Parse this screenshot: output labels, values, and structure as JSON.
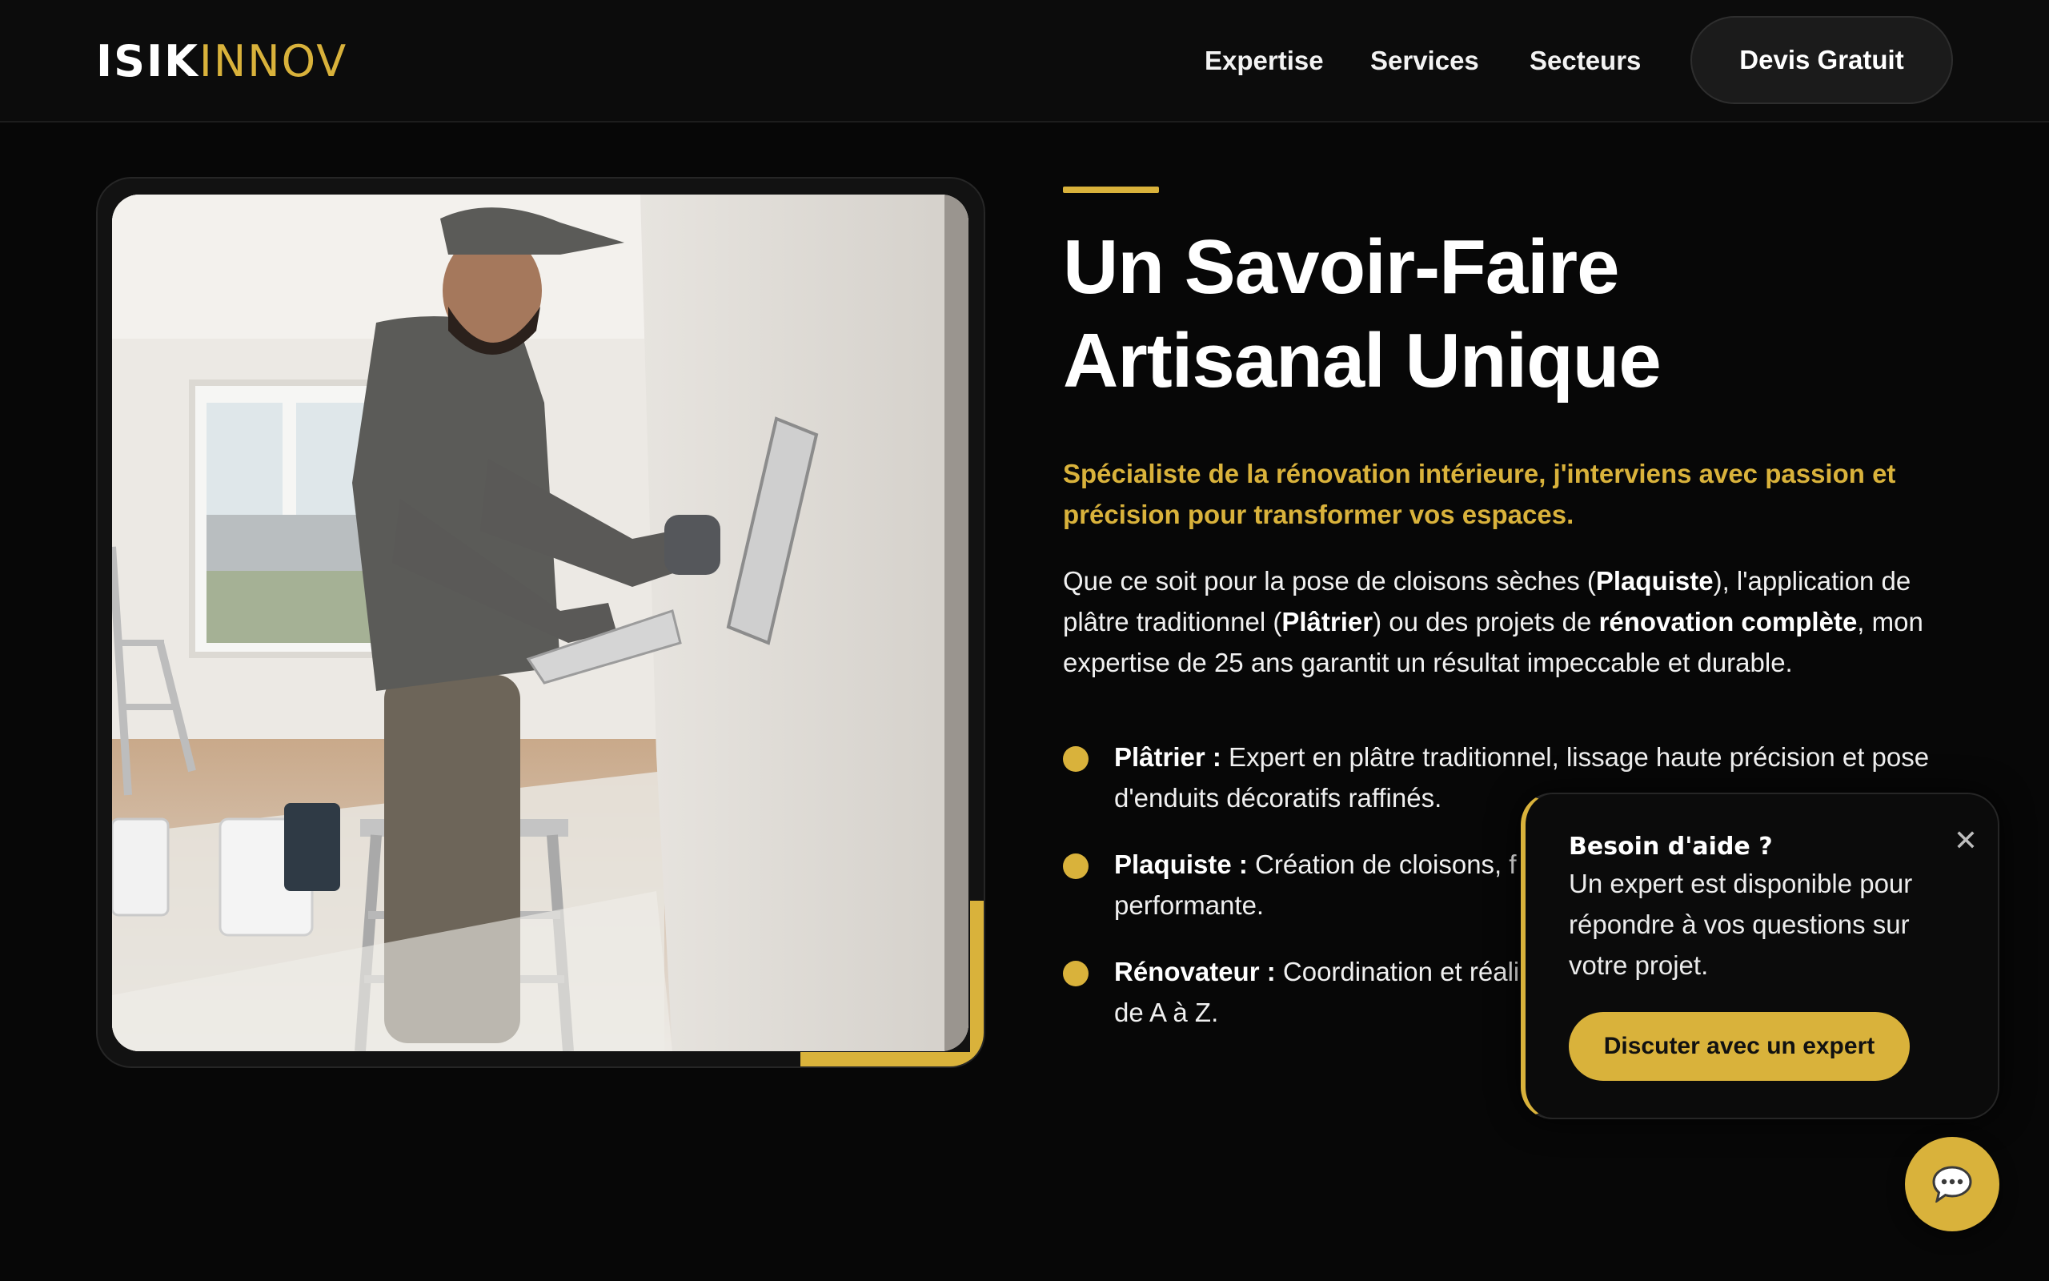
{
  "header": {
    "logo_part1": "ISIK",
    "logo_part2": "INNOV",
    "nav": [
      "Expertise",
      "Services",
      "Secteurs"
    ],
    "cta_label": "Devis Gratuit"
  },
  "hero": {
    "title_line1": "Un Savoir-Faire",
    "title_line2": "Artisanal Unique",
    "lead": "Spécialiste de la rénovation intérieure, j'interviens avec passion et précision pour transformer vos espaces.",
    "body": {
      "t1": "Que ce soit pour la pose de cloisons sèches (",
      "b1": "Plaquiste",
      "t2": "), l'application de plâtre traditionnel (",
      "b2": "Plâtrier",
      "t3": ") ou des projets de ",
      "b3": "rénovation complète",
      "t4": ", mon expertise de 25 ans garantit un résultat impeccable et durable."
    },
    "bullets": [
      {
        "label": "Plâtrier :",
        "text": " Expert en plâtre traditionnel, lissage haute précision et pose d'enduits décoratifs raffinés."
      },
      {
        "label": "Plaquiste :",
        "text": " Création de cloisons, f",
        "text2": "performante."
      },
      {
        "label": "Rénovateur :",
        "text": " Coordination et réali",
        "text2": "de A à Z."
      }
    ]
  },
  "help_popup": {
    "title": "Besoin d'aide ?",
    "close": "✕",
    "message": "Un expert est disponible pour répondre à vos questions sur votre projet.",
    "button": "Discuter avec un expert"
  },
  "colors": {
    "accent": "#d9b23b",
    "background": "#070707"
  },
  "icons": {
    "chat": "chat-bubble-icon",
    "close": "close-icon"
  }
}
